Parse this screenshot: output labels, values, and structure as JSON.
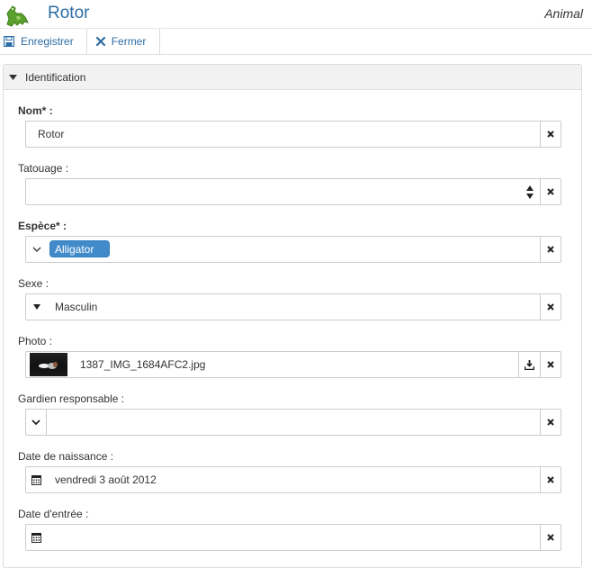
{
  "header": {
    "title": "Rotor",
    "entity_type": "Animal",
    "icon": "dinosaur-icon"
  },
  "toolbar": {
    "save_label": "Enregistrer",
    "save_icon": "floppy-disk-icon",
    "close_label": "Fermer",
    "close_icon": "close-x-icon"
  },
  "panel": {
    "title": "Identification"
  },
  "fields": {
    "nom": {
      "label": "Nom* :",
      "value": "Rotor"
    },
    "tatouage": {
      "label": "Tatouage  :",
      "value": ""
    },
    "espece": {
      "label": "Espèce* :",
      "value": "Alligator"
    },
    "sexe": {
      "label": "Sexe  :",
      "value": "Masculin"
    },
    "photo": {
      "label": "Photo  :",
      "value": "1387_IMG_1684AFC2.jpg"
    },
    "gardien": {
      "label": "Gardien responsable  :",
      "value": ""
    },
    "naissance": {
      "label": "Date de naissance  :",
      "value": "vendredi 3 août 2012"
    },
    "entree": {
      "label": "Date d'entrée  :",
      "value": ""
    }
  },
  "colors": {
    "link_blue": "#2e6da4",
    "tag_blue": "#428bca",
    "icon_green": "#5aa02c"
  }
}
